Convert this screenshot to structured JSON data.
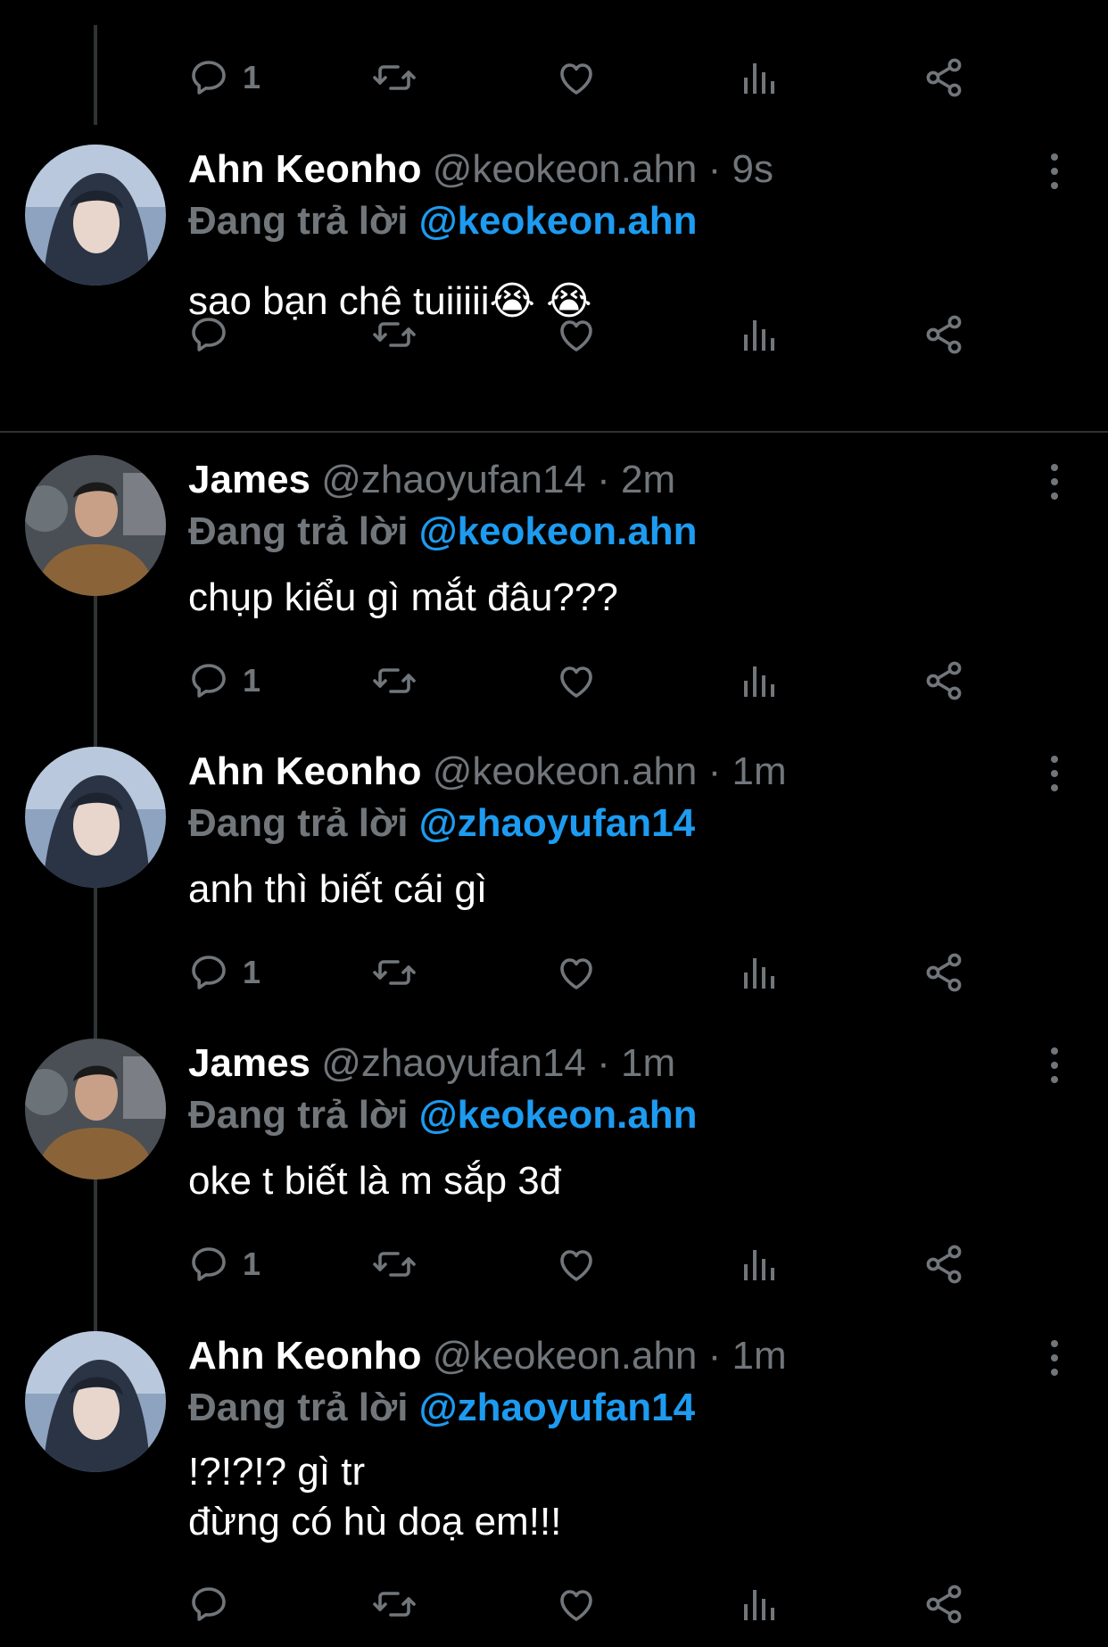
{
  "colors": {
    "background": "#000000",
    "text_primary": "#ffffff",
    "text_secondary": "#71767b",
    "accent": "#1d9bf0",
    "line": "#2f3336"
  },
  "icons": {
    "reply": "reply-icon",
    "retweet": "retweet-icon",
    "like": "like-icon",
    "views": "views-icon",
    "share": "share-icon",
    "more": "more-icon"
  },
  "top_actions": {
    "reply_count": "1"
  },
  "tweets": [
    {
      "name": "Ahn Keonho",
      "handle": "@keokeon.ahn",
      "dot": "·",
      "time": "9s",
      "replying_label": "Đang trả lời",
      "replying_to": "@keokeon.ahn",
      "text_lines": [
        "sao bạn chê tuiiiii😭 😭"
      ],
      "reply_count": ""
    },
    {
      "name": "James",
      "handle": "@zhaoyufan14",
      "dot": "·",
      "time": "2m",
      "replying_label": "Đang trả lời",
      "replying_to": "@keokeon.ahn",
      "text_lines": [
        "chụp kiểu gì mắt đâu???"
      ],
      "reply_count": "1"
    },
    {
      "name": "Ahn Keonho",
      "handle": "@keokeon.ahn",
      "dot": "·",
      "time": "1m",
      "replying_label": "Đang trả lời",
      "replying_to": "@zhaoyufan14",
      "text_lines": [
        "anh thì biết cái gì"
      ],
      "reply_count": "1"
    },
    {
      "name": "James",
      "handle": "@zhaoyufan14",
      "dot": "·",
      "time": "1m",
      "replying_label": "Đang trả lời",
      "replying_to": "@keokeon.ahn",
      "text_lines": [
        "oke t biết là m sắp 3đ"
      ],
      "reply_count": "1"
    },
    {
      "name": "Ahn Keonho",
      "handle": "@keokeon.ahn",
      "dot": "·",
      "time": "1m",
      "replying_label": "Đang trả lời",
      "replying_to": "@zhaoyufan14",
      "text_lines": [
        "!?!?!? gì tr",
        "đừng có hù doạ em!!!"
      ],
      "reply_count": ""
    }
  ]
}
